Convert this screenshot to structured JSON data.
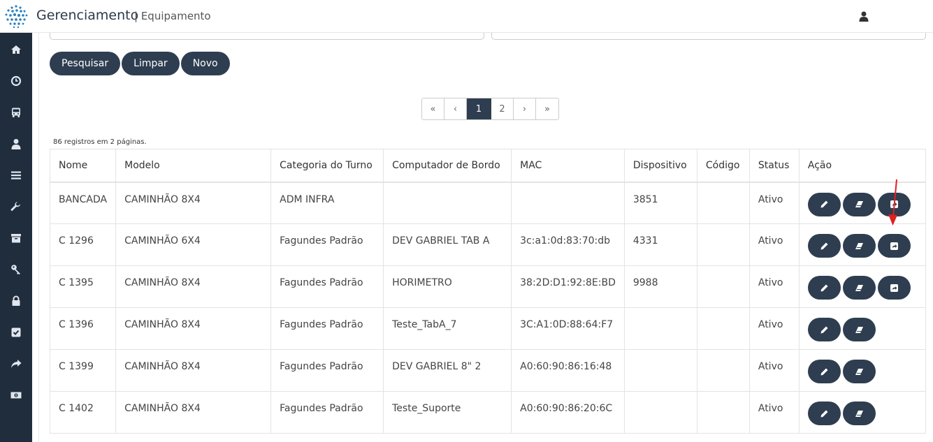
{
  "app": {
    "title": "Gerenciamento",
    "subtitle": "| Equipamento"
  },
  "toolbar": {
    "search": "Pesquisar",
    "clear": "Limpar",
    "new": "Novo"
  },
  "pagination": {
    "first": "«",
    "prev": "‹",
    "pages": [
      "1",
      "2"
    ],
    "next": "›",
    "last": "»",
    "active": "1"
  },
  "summary": "86 registros em 2 páginas.",
  "table": {
    "headers": [
      "Nome",
      "Modelo",
      "Categoria do Turno",
      "Computador de Bordo",
      "MAC",
      "Dispositivo",
      "Código",
      "Status",
      "Ação"
    ],
    "rows": [
      {
        "nome": "BANCADA",
        "modelo": "CAMINHÃO 8X4",
        "categoria": "ADM INFRA",
        "computador": "",
        "mac": "",
        "dispositivo": "3851",
        "codigo": "",
        "status": "Ativo"
      },
      {
        "nome": "C 1296",
        "modelo": "CAMINHÃO 6X4",
        "categoria": "Fagundes Padrão",
        "computador": "DEV GABRIEL TAB A",
        "mac": "3c:a1:0d:83:70:db",
        "dispositivo": "4331",
        "codigo": "",
        "status": "Ativo"
      },
      {
        "nome": "C 1395",
        "modelo": "CAMINHÃO 8X4",
        "categoria": "Fagundes Padrão",
        "computador": "HORIMETRO",
        "mac": "38:2D:D1:92:8E:BD",
        "dispositivo": "9988",
        "codigo": "",
        "status": "Ativo"
      },
      {
        "nome": "C 1396",
        "modelo": "CAMINHÃO 8X4",
        "categoria": "Fagundes Padrão",
        "computador": "Teste_TabA_7",
        "mac": "3C:A1:0D:88:64:F7",
        "dispositivo": "",
        "codigo": "",
        "status": "Ativo"
      },
      {
        "nome": "C 1399",
        "modelo": "CAMINHÃO 8X4",
        "categoria": "Fagundes Padrão",
        "computador": "DEV GABRIEL 8\" 2",
        "mac": "A0:60:90:86:16:48",
        "dispositivo": "",
        "codigo": "",
        "status": "Ativo"
      },
      {
        "nome": "C 1402",
        "modelo": "CAMINHÃO 8X4",
        "categoria": "Fagundes Padrão",
        "computador": "Teste_Suporte",
        "mac": "A0:60:90:86:20:6C",
        "dispositivo": "",
        "codigo": "",
        "status": "Ativo"
      }
    ]
  },
  "sidebar": [
    "home-icon",
    "clock-icon",
    "bus-icon",
    "user-icon",
    "list-icon",
    "wrench-icon",
    "archive-icon",
    "key-icon",
    "lock-icon",
    "check-square-icon",
    "share-icon",
    "money-icon"
  ],
  "colors": {
    "primary": "#2e3e50",
    "sidebar": "#1f2d3d",
    "annotation": "#e02020"
  }
}
